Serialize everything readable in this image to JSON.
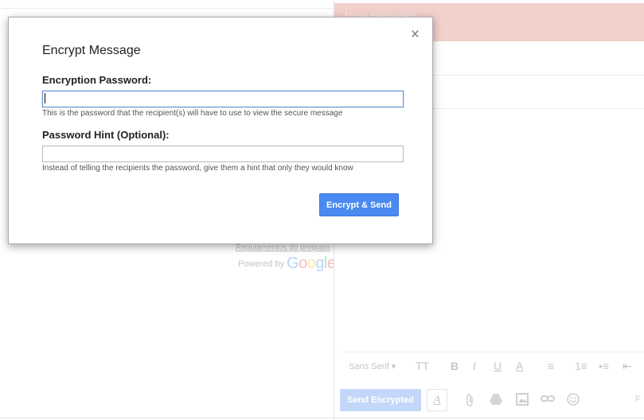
{
  "background": {
    "footer_link": "Regulamentos do program",
    "powered_by": "Powered by",
    "google_logo": [
      "G",
      "o",
      "o",
      "g",
      "l",
      "e"
    ]
  },
  "compose": {
    "title": "Nova mensagem",
    "format_bar": {
      "font": "Sans Serif",
      "items": [
        "TT",
        "B",
        "I",
        "U",
        "A",
        "≡",
        "1≡",
        "•≡",
        "⇤",
        "⇥"
      ]
    },
    "send_button": "Send Encrypted",
    "format_toggle": "A",
    "extra": "F"
  },
  "modal": {
    "title": "Encrypt Message",
    "close": "×",
    "password_label": "Encryption Password:",
    "password_value": "",
    "password_help": "This is the password that the recipient(s) will have to use to view the secure message",
    "hint_label": "Password Hint (Optional):",
    "hint_value": "",
    "hint_help": "Instead of telling the recipients the password, give them a hint that only they would know",
    "submit": "Encrypt & Send"
  },
  "colors": {
    "header_bg": "#f2d0cb",
    "primary_button": "#4a8af0",
    "disabled_button": "#c3d8f8"
  }
}
